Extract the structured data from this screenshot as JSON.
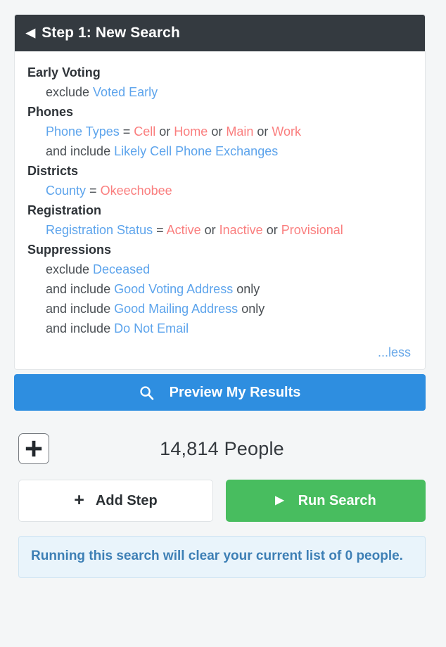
{
  "step_card": {
    "header": {
      "back_icon": "back-caret-icon",
      "title": "Step 1: New Search"
    },
    "groups": [
      {
        "title": "Early Voting",
        "lines": [
          [
            {
              "text": "exclude ",
              "style": "op"
            },
            {
              "text": "Voted Early",
              "style": "field"
            }
          ]
        ]
      },
      {
        "title": "Phones",
        "lines": [
          [
            {
              "text": "Phone Types",
              "style": "field"
            },
            {
              "text": " = ",
              "style": "op"
            },
            {
              "text": "Cell",
              "style": "value"
            },
            {
              "text": " or ",
              "style": "op"
            },
            {
              "text": "Home",
              "style": "value"
            },
            {
              "text": " or ",
              "style": "op"
            },
            {
              "text": "Main",
              "style": "value"
            },
            {
              "text": " or ",
              "style": "op"
            },
            {
              "text": "Work",
              "style": "value"
            }
          ],
          [
            {
              "text": "and include ",
              "style": "op"
            },
            {
              "text": "Likely Cell Phone Exchanges",
              "style": "field"
            }
          ]
        ]
      },
      {
        "title": "Districts",
        "lines": [
          [
            {
              "text": "County",
              "style": "field"
            },
            {
              "text": " = ",
              "style": "op"
            },
            {
              "text": "Okeechobee",
              "style": "value"
            }
          ]
        ]
      },
      {
        "title": "Registration",
        "lines": [
          [
            {
              "text": "Registration Status",
              "style": "field"
            },
            {
              "text": " = ",
              "style": "op"
            },
            {
              "text": "Active",
              "style": "value"
            },
            {
              "text": " or ",
              "style": "op"
            },
            {
              "text": "Inactive",
              "style": "value"
            },
            {
              "text": " or ",
              "style": "op"
            },
            {
              "text": "Provisional",
              "style": "value"
            }
          ]
        ]
      },
      {
        "title": "Suppressions",
        "lines": [
          [
            {
              "text": "exclude ",
              "style": "op"
            },
            {
              "text": "Deceased",
              "style": "field"
            }
          ],
          [
            {
              "text": "and include ",
              "style": "op"
            },
            {
              "text": "Good Voting Address",
              "style": "field"
            },
            {
              "text": " only",
              "style": "op"
            }
          ],
          [
            {
              "text": "and include ",
              "style": "op"
            },
            {
              "text": "Good Mailing Address",
              "style": "field"
            },
            {
              "text": " only",
              "style": "op"
            }
          ],
          [
            {
              "text": "and include ",
              "style": "op"
            },
            {
              "text": "Do Not Email",
              "style": "field"
            }
          ]
        ]
      }
    ],
    "collapse_link": "...less"
  },
  "preview_button": {
    "icon": "search-icon",
    "label": "Preview My Results"
  },
  "count_row": {
    "add_icon": "plus-icon",
    "label": "14,814 People"
  },
  "actions": {
    "add_step": {
      "icon": "plus-icon",
      "label": "Add Step"
    },
    "run_search": {
      "icon": "play-icon",
      "label": "Run Search"
    }
  },
  "notice": {
    "message": "Running this search will clear your current list of 0 people."
  },
  "colors": {
    "header_bg": "#343a40",
    "field_blue": "#5da4ec",
    "value_red": "#fa7e7e",
    "preview_blue": "#2e8ee0",
    "run_green": "#48bd5f",
    "notice_bg": "#e9f4fb",
    "notice_text": "#3d7fb5",
    "page_bg": "#f4f6f7"
  }
}
